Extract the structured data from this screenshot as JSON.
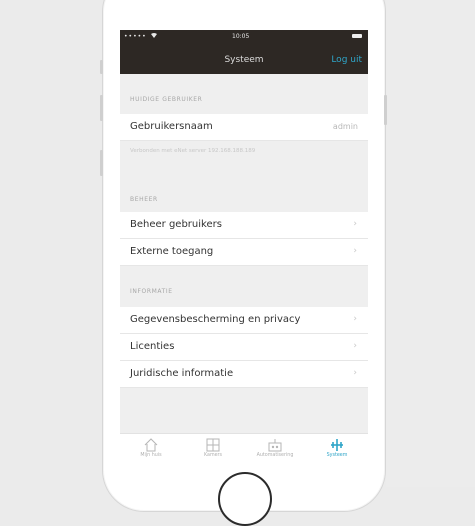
{
  "status_bar": {
    "signal": "•••••",
    "time": "10:05"
  },
  "navbar": {
    "title": "Systeem",
    "action": "Log uit"
  },
  "sections": {
    "current_user": {
      "header": "HUIDIGE GEBRUIKER",
      "row_label": "Gebruikersnaam",
      "row_value": "admin",
      "footnote": "Verbonden met eNet server 192.168.188.189"
    },
    "manage": {
      "header": "BEHEER",
      "items": [
        {
          "label": "Beheer gebruikers"
        },
        {
          "label": "Externe toegang"
        }
      ]
    },
    "info": {
      "header": "INFORMATIE",
      "items": [
        {
          "label": "Gegevensbescherming en privacy"
        },
        {
          "label": "Licenties"
        },
        {
          "label": "Juridische informatie"
        }
      ]
    }
  },
  "chevron": "›",
  "tabbar": {
    "tabs": [
      {
        "label": "Mijn huis",
        "icon": "home-icon"
      },
      {
        "label": "Kamers",
        "icon": "rooms-icon"
      },
      {
        "label": "Automatisering",
        "icon": "automation-icon"
      },
      {
        "label": "Systeem",
        "icon": "system-icon",
        "active": true
      }
    ]
  },
  "colors": {
    "navbar_bg": "#2d2824",
    "accent": "#2fa5c8"
  }
}
